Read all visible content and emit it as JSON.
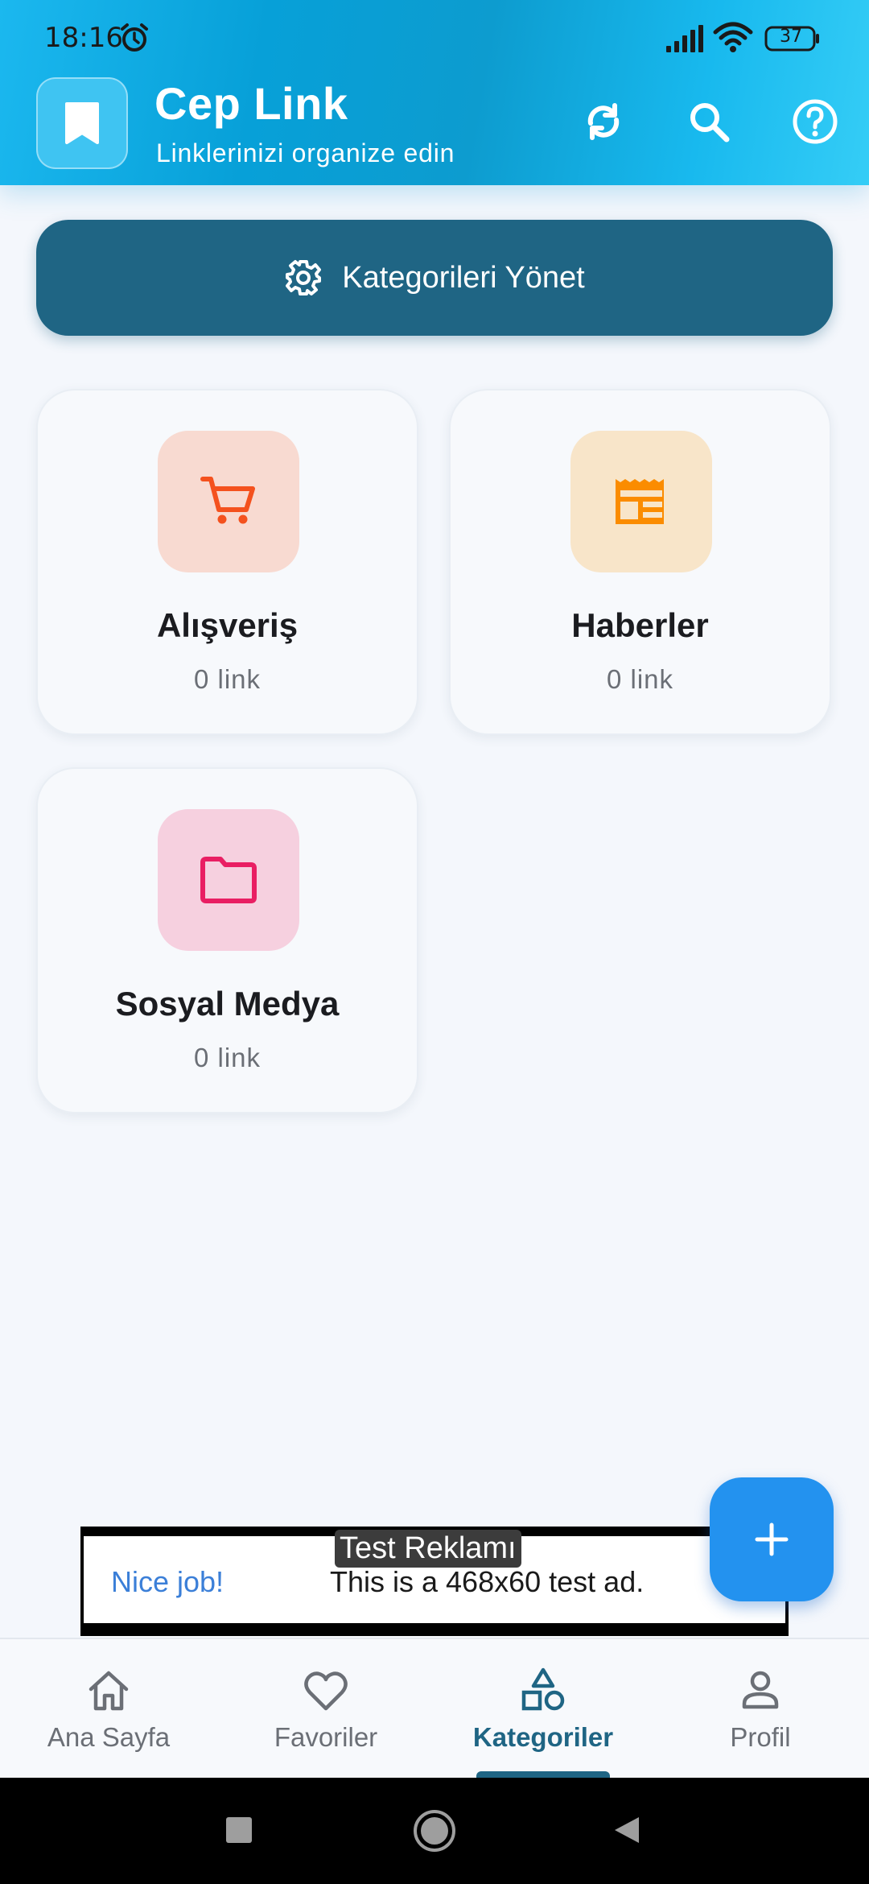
{
  "status_bar": {
    "time": "18:16",
    "battery": "37"
  },
  "app": {
    "title": "Cep Link",
    "subtitle": "Linklerinizi organize edin"
  },
  "header_actions": [
    "sync-icon",
    "search-icon",
    "help-icon"
  ],
  "manage_button": {
    "label": "Kategorileri Yönet"
  },
  "categories": [
    {
      "name": "Alışveriş",
      "count": "0 link",
      "icon": "cart-icon",
      "color": "#f4511e"
    },
    {
      "name": "Haberler",
      "count": "0 link",
      "icon": "newspaper-icon",
      "color": "#fb8c00"
    },
    {
      "name": "Sosyal Medya",
      "count": "0 link",
      "icon": "folder-icon",
      "color": "#e91e63"
    }
  ],
  "ad": {
    "label": "Test Reklamı",
    "headline": "Nice job!",
    "text": "This is a 468x60 test ad."
  },
  "bottom_nav": {
    "items": [
      {
        "label": "Ana Sayfa",
        "icon": "home-icon"
      },
      {
        "label": "Favoriler",
        "icon": "heart-icon"
      },
      {
        "label": "Kategoriler",
        "icon": "shapes-icon",
        "active": true
      },
      {
        "label": "Profil",
        "icon": "person-icon"
      }
    ]
  },
  "colors": {
    "primary": "#1f6584",
    "header": "#0ea5dc",
    "fab": "#2392ef"
  }
}
